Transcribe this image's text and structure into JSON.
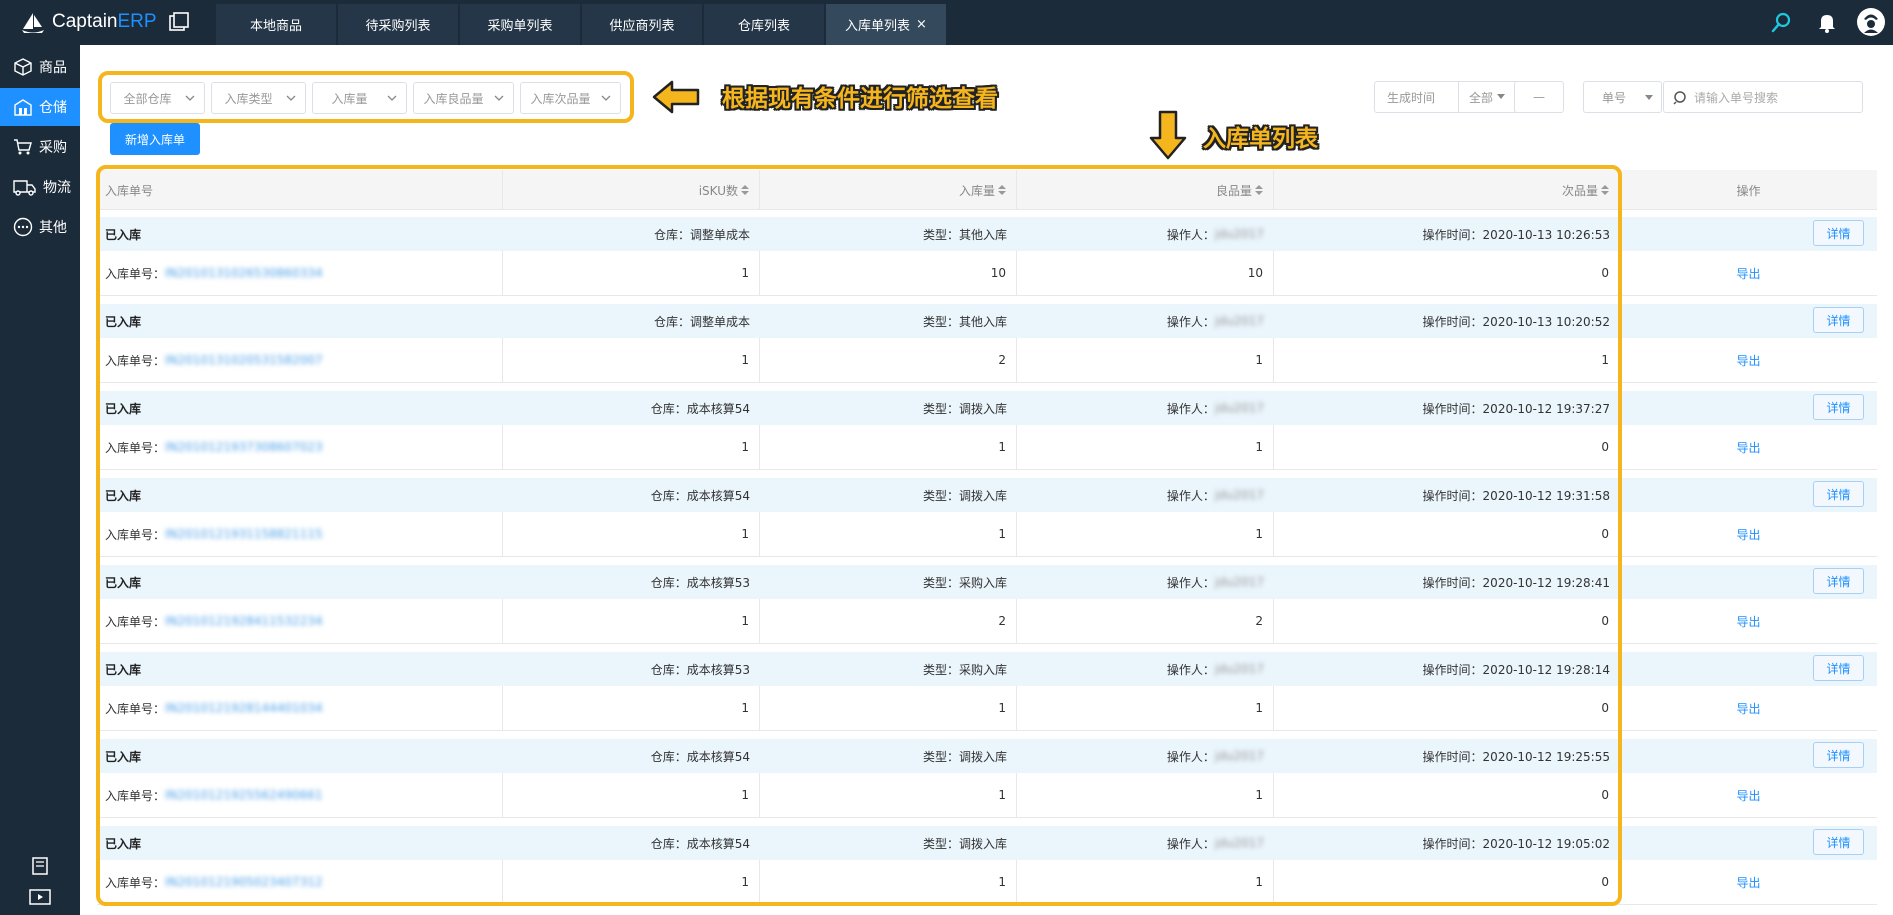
{
  "app": {
    "logo_main": "Captain",
    "logo_accent": "ERP"
  },
  "tabs": [
    {
      "label": "本地商品",
      "active": false
    },
    {
      "label": "待采购列表",
      "active": false
    },
    {
      "label": "采购单列表",
      "active": false
    },
    {
      "label": "供应商列表",
      "active": false
    },
    {
      "label": "仓库列表",
      "active": false
    },
    {
      "label": "入库单列表",
      "active": true,
      "close": "×"
    }
  ],
  "sidebar": {
    "items": [
      {
        "label": "商品",
        "icon": "cube-icon",
        "active": false
      },
      {
        "label": "仓储",
        "icon": "warehouse-icon",
        "active": true
      },
      {
        "label": "采购",
        "icon": "cart-icon",
        "active": false
      },
      {
        "label": "物流",
        "icon": "truck-icon",
        "active": false
      },
      {
        "label": "其他",
        "icon": "more-icon",
        "active": false
      }
    ]
  },
  "filters": {
    "warehouse": "全部仓库",
    "inbound_type": "入库类型",
    "quantity": "入库量",
    "good_quantity": "入库良品量",
    "defect_quantity": "入库次品量"
  },
  "date_filter": {
    "label": "生成时间",
    "range": "全部",
    "dash": "—"
  },
  "search": {
    "field": "单号",
    "placeholder": "请输入单号搜索"
  },
  "new_button": "新增入库单",
  "annotations": {
    "filter_note": "根据现有条件进行筛选查看",
    "list_note": "入库单列表"
  },
  "table": {
    "headers": [
      "入库单号",
      "iSKU数",
      "入库量",
      "良品量",
      "次品量",
      "操作"
    ],
    "detail_label": "详情",
    "export_label": "导出",
    "order_prefix": "入库单号：",
    "rows": [
      {
        "status": "已入库",
        "warehouse": "仓库：调整单成本",
        "type": "类型：其他入库",
        "operator_label": "操作人：",
        "operator": "jdu2017",
        "time": "操作时间：2020-10-13 10:26:53",
        "order_no": "IN2010131026530860334",
        "isku": "1",
        "qty": "10",
        "good": "10",
        "defect": "0"
      },
      {
        "status": "已入库",
        "warehouse": "仓库：调整单成本",
        "type": "类型：其他入库",
        "operator_label": "操作人：",
        "operator": "jdu2017",
        "time": "操作时间：2020-10-13 10:20:52",
        "order_no": "IN2010131020531582007",
        "isku": "1",
        "qty": "2",
        "good": "1",
        "defect": "1"
      },
      {
        "status": "已入库",
        "warehouse": "仓库：成本核算54",
        "type": "类型：调拨入库",
        "operator_label": "操作人：",
        "operator": "jdu2017",
        "time": "操作时间：2020-10-12 19:37:27",
        "order_no": "IN2010121937308607023",
        "isku": "1",
        "qty": "1",
        "good": "1",
        "defect": "0"
      },
      {
        "status": "已入库",
        "warehouse": "仓库：成本核算54",
        "type": "类型：调拨入库",
        "operator_label": "操作人：",
        "operator": "jdu2017",
        "time": "操作时间：2020-10-12 19:31:58",
        "order_no": "IN2010121931158821115",
        "isku": "1",
        "qty": "1",
        "good": "1",
        "defect": "0"
      },
      {
        "status": "已入库",
        "warehouse": "仓库：成本核算53",
        "type": "类型：采购入库",
        "operator_label": "操作人：",
        "operator": "jdu2017",
        "time": "操作时间：2020-10-12 19:28:41",
        "order_no": "IN2010121928411532234",
        "isku": "1",
        "qty": "2",
        "good": "2",
        "defect": "0"
      },
      {
        "status": "已入库",
        "warehouse": "仓库：成本核算53",
        "type": "类型：采购入库",
        "operator_label": "操作人：",
        "operator": "jdu2017",
        "time": "操作时间：2020-10-12 19:28:14",
        "order_no": "IN2010121928144401034",
        "isku": "1",
        "qty": "1",
        "good": "1",
        "defect": "0"
      },
      {
        "status": "已入库",
        "warehouse": "仓库：成本核算54",
        "type": "类型：调拨入库",
        "operator_label": "操作人：",
        "operator": "jdu2017",
        "time": "操作时间：2020-10-12 19:25:55",
        "order_no": "IN2010121925562490661",
        "isku": "1",
        "qty": "1",
        "good": "1",
        "defect": "0"
      },
      {
        "status": "已入库",
        "warehouse": "仓库：成本核算54",
        "type": "类型：调拨入库",
        "operator_label": "操作人：",
        "operator": "jdu2017",
        "time": "操作时间：2020-10-12 19:05:02",
        "order_no": "IN2010121905023407312",
        "isku": "1",
        "qty": "1",
        "good": "1",
        "defect": "0"
      }
    ]
  },
  "colors": {
    "accent": "#1e90ff",
    "sidebar_bg": "#1c2b3a",
    "highlight": "#f5b51d",
    "row_head_bg": "#eaf5fc"
  }
}
